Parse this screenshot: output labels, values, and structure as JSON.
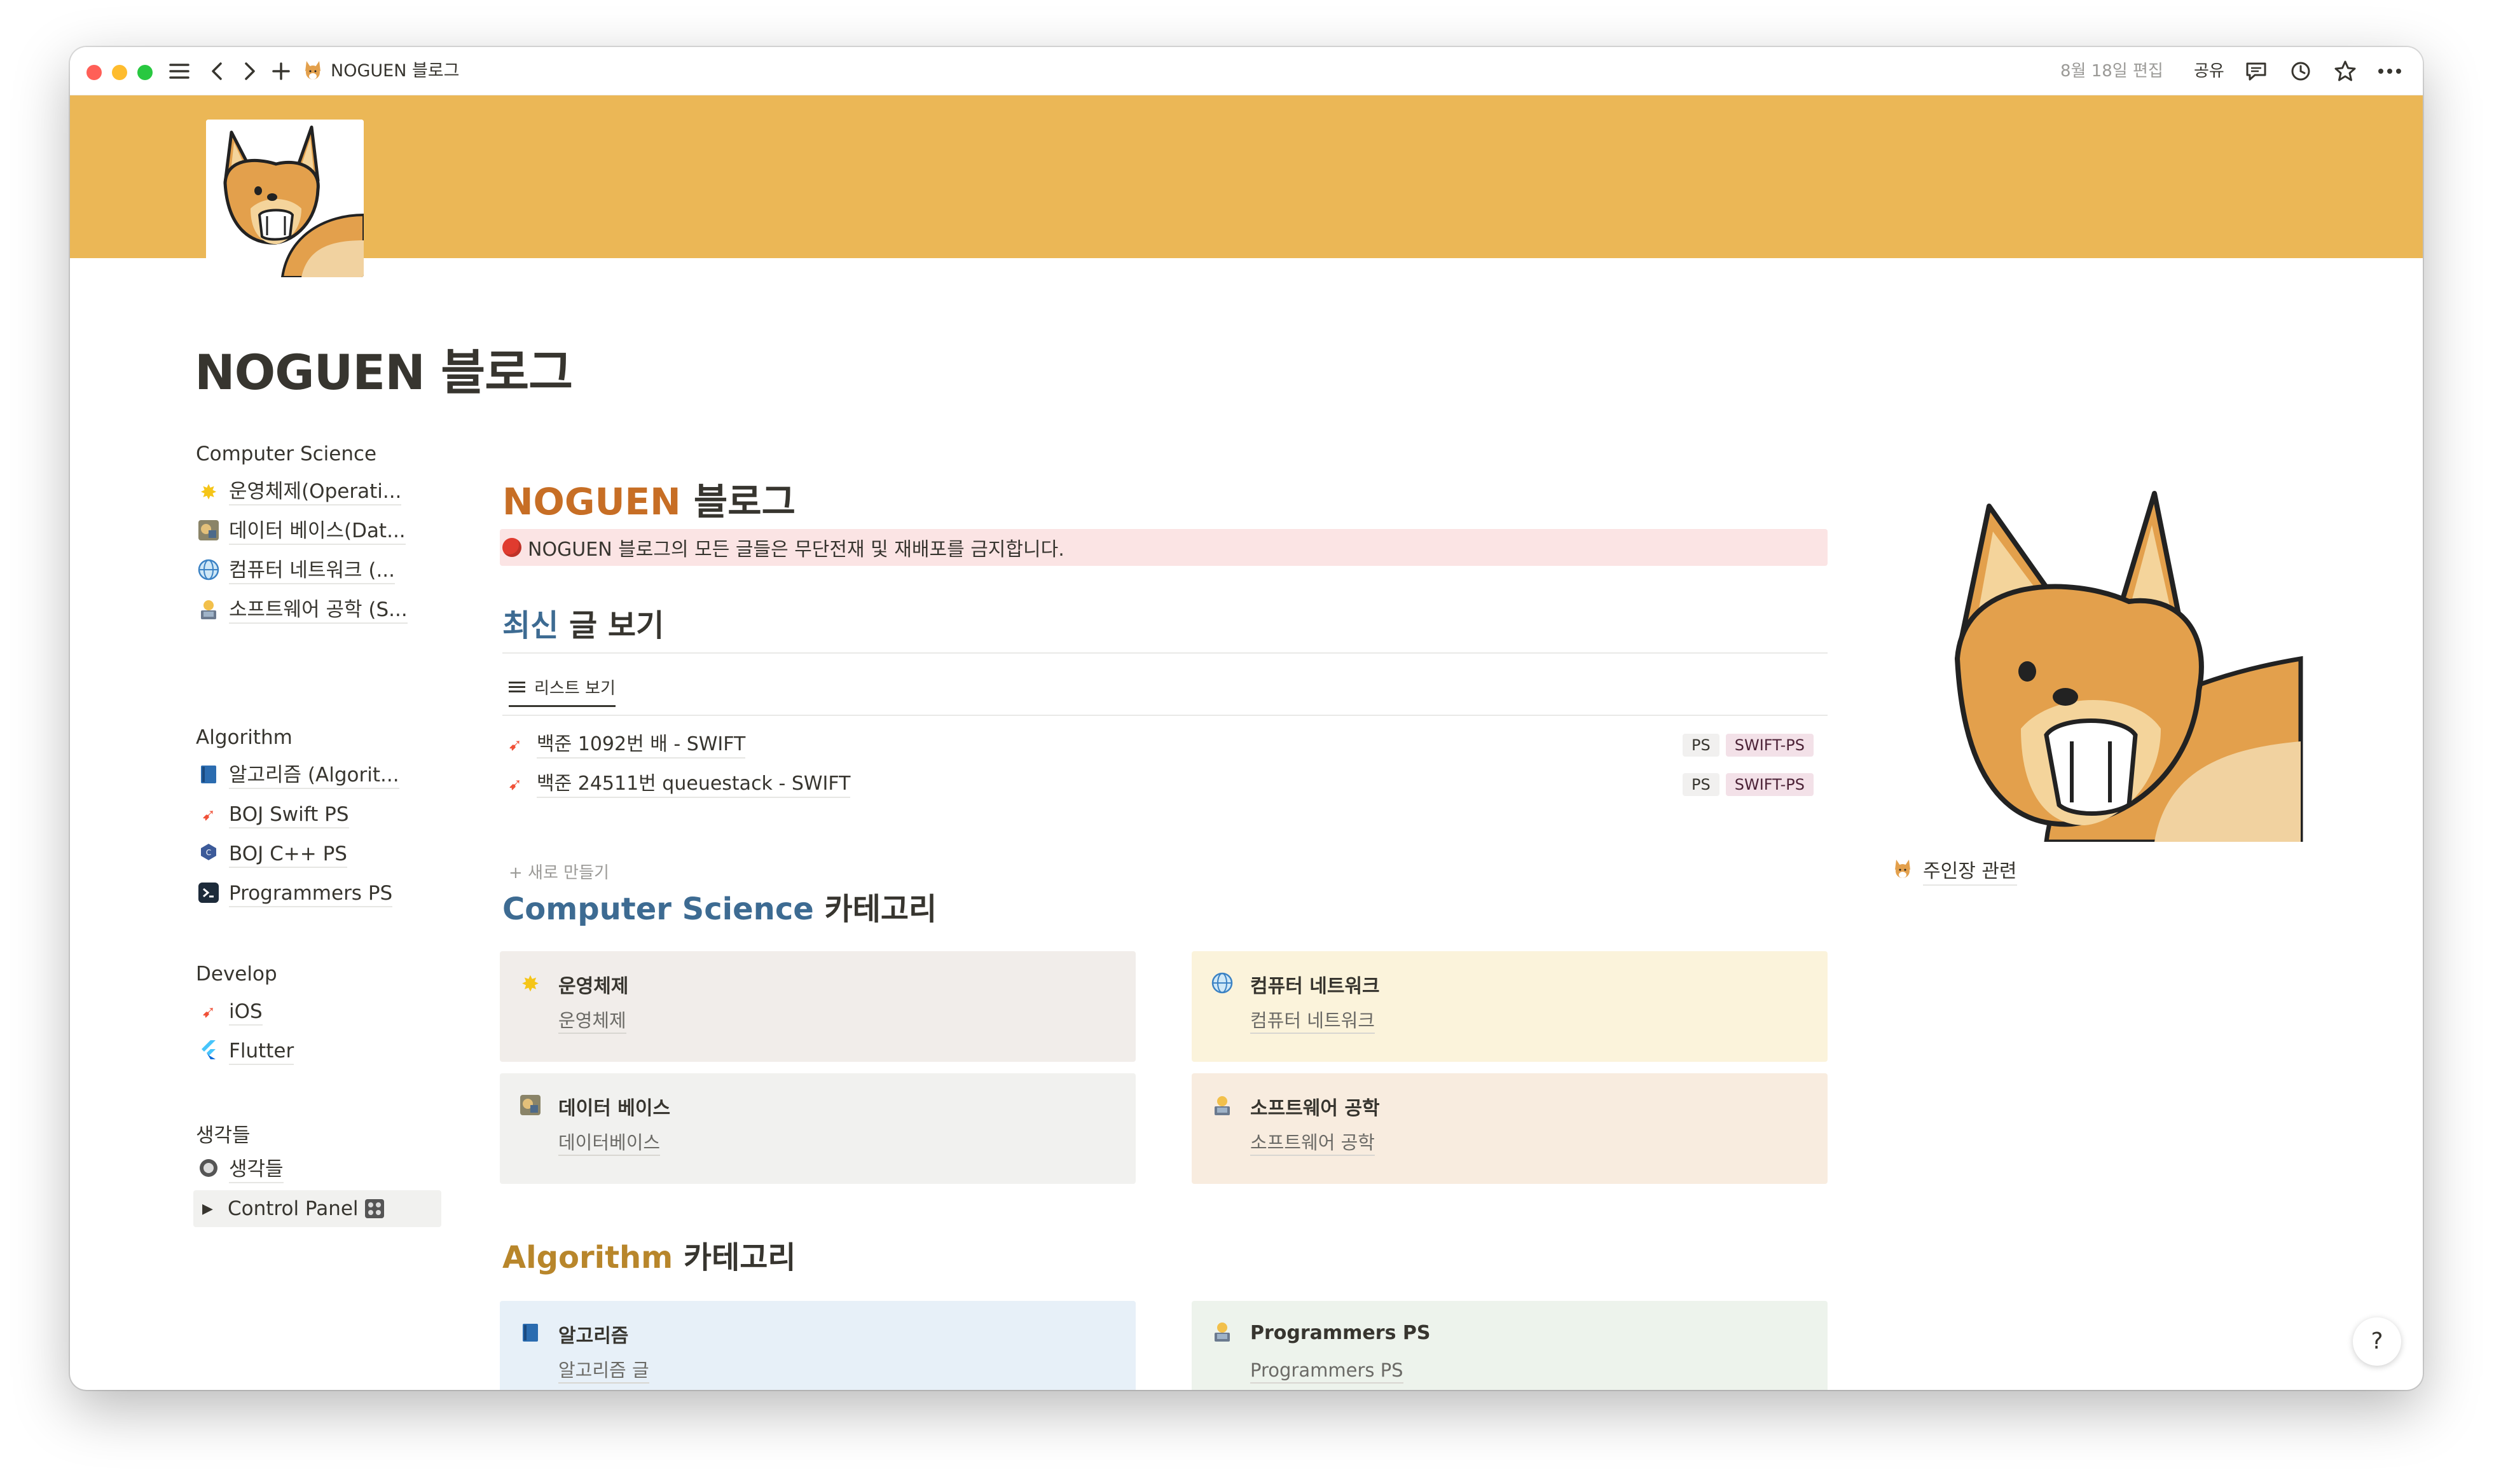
{
  "titlebar": {
    "title": "NOGUEN 블로그",
    "edited": "8월 18일 편집",
    "share": "공유",
    "icons": [
      "menu-icon",
      "back-icon",
      "forward-icon",
      "add-icon",
      "comment-icon",
      "clock-icon",
      "star-icon",
      "more-icon"
    ]
  },
  "page": {
    "title": "NOGUEN 블로그"
  },
  "sidebar": {
    "groups": [
      {
        "title": "Computer Science",
        "items": [
          {
            "label": "운영체제(Operati...",
            "icon": "star-icon"
          },
          {
            "label": "데이터 베이스(Dat...",
            "icon": "database-icon"
          },
          {
            "label": "컴퓨터 네트워크 (...",
            "icon": "globe-icon"
          },
          {
            "label": "소프트웨어 공학 (S...",
            "icon": "technologist-icon"
          }
        ]
      },
      {
        "title": "Algorithm",
        "items": [
          {
            "label": "알고리즘 (Algorit...",
            "icon": "book-icon"
          },
          {
            "label": "BOJ Swift PS",
            "icon": "swift-icon"
          },
          {
            "label": "BOJ C++ PS",
            "icon": "cpp-icon"
          },
          {
            "label": "Programmers PS",
            "icon": "programmers-icon"
          }
        ]
      },
      {
        "title": "Develop",
        "items": [
          {
            "label": "iOS",
            "icon": "swift-icon"
          },
          {
            "label": "Flutter",
            "icon": "flutter-icon"
          }
        ]
      },
      {
        "title": "생각들",
        "items": [
          {
            "label": "생각들",
            "icon": "circle-icon"
          }
        ]
      }
    ],
    "toggle": "Control Panel"
  },
  "main": {
    "heading_colored": "NOGUEN",
    "heading_rest": " 블로그",
    "notice": "NOGUEN 블로그의 모든 글들은 무단전재 및 재배포를 금지합니다.",
    "latest_colored": "최신",
    "latest_rest": " 글 보기",
    "view_tab": "리스트 보기",
    "rows": [
      {
        "title": "백준 1092번 배 - SWIFT",
        "tags": [
          "PS",
          "SWIFT-PS"
        ]
      },
      {
        "title": "백준 24511번 queuestack - SWIFT",
        "tags": [
          "PS",
          "SWIFT-PS"
        ]
      }
    ],
    "new_item": "+ 새로 만들기",
    "cs_colored": "Computer Science",
    "cs_rest": " 카테고리",
    "cs_cards": [
      {
        "title": "운영체제",
        "sub": "운영체제",
        "icon": "star-icon",
        "bg": "#f1edea"
      },
      {
        "title": "컴퓨터 네트워크",
        "sub": "컴퓨터 네트워크",
        "icon": "globe-icon",
        "bg": "#fbf3db"
      },
      {
        "title": "데이터 베이스",
        "sub": "데이터베이스",
        "icon": "database-icon",
        "bg": "#f1f1ef"
      },
      {
        "title": "소프트웨어 공학",
        "sub": "소프트웨어 공학",
        "icon": "technologist-icon",
        "bg": "#f8ecdf"
      }
    ],
    "algo_colored": "Algorithm",
    "algo_rest": " 카테고리",
    "algo_cards": [
      {
        "title": "알고리즘",
        "sub": "알고리즘 글",
        "icon": "book-icon",
        "bg": "#e7f0f8"
      },
      {
        "title": "Programmers PS",
        "sub": "Programmers PS",
        "icon": "technologist-icon",
        "bg": "#edf3ec"
      }
    ]
  },
  "right": {
    "owner_link": "주인장 관련"
  },
  "help": "?",
  "colors": {
    "cover": "#ebb756",
    "accent_orange": "#c76e25",
    "accent_blue": "#3d6b92",
    "accent_gold": "#b8862b"
  }
}
